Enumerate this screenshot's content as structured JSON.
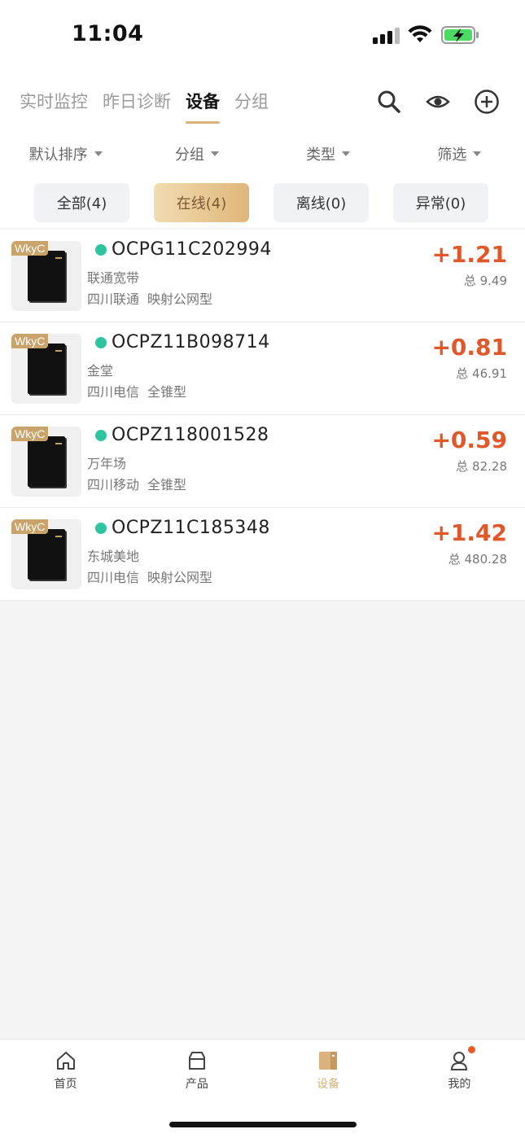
{
  "status_bar": {
    "time": "11:04"
  },
  "header": {
    "tabs": [
      {
        "label": "实时监控",
        "active": false
      },
      {
        "label": "昨日诊断",
        "active": false
      },
      {
        "label": "设备",
        "active": true
      },
      {
        "label": "分组",
        "active": false
      }
    ],
    "icons": [
      "search-icon",
      "eye-icon",
      "add-circle-icon"
    ],
    "sort_options": [
      {
        "label": "默认排序"
      },
      {
        "label": "分组"
      },
      {
        "label": "类型"
      },
      {
        "label": "筛选"
      }
    ],
    "filters": [
      {
        "label": "全部(4)",
        "active": false
      },
      {
        "label": "在线(4)",
        "active": true
      },
      {
        "label": "离线(0)",
        "active": false
      },
      {
        "label": "异常(0)",
        "active": false
      }
    ]
  },
  "devices": [
    {
      "tag": "WkyC",
      "id": "OCPG11C202994",
      "name": "联通宽带",
      "isp": "四川联通",
      "type": "映射公网型",
      "delta": "+1.21",
      "total": "总 9.49",
      "online": true
    },
    {
      "tag": "WkyC",
      "id": "OCPZ11B098714",
      "name": "金堂",
      "isp": "四川电信",
      "type": "全锥型",
      "delta": "+0.81",
      "total": "总 46.91",
      "online": true
    },
    {
      "tag": "WkyC",
      "id": "OCPZ118001528",
      "name": "万年场",
      "isp": "四川移动",
      "type": "全锥型",
      "delta": "+0.59",
      "total": "总 82.28",
      "online": true
    },
    {
      "tag": "WkyC",
      "id": "OCPZ11C185348",
      "name": "东城美地",
      "isp": "四川电信",
      "type": "映射公网型",
      "delta": "+1.42",
      "total": "总 480.28",
      "online": true
    }
  ],
  "bottom_nav": [
    {
      "label": "首页",
      "icon": "home-icon",
      "active": false
    },
    {
      "label": "产品",
      "icon": "box-icon",
      "active": false
    },
    {
      "label": "设备",
      "icon": "device-icon",
      "active": true
    },
    {
      "label": "我的",
      "icon": "profile-icon",
      "active": false,
      "badge": true
    }
  ],
  "colors": {
    "accent": "#d9b27c",
    "delta": "#e0582a",
    "online": "#2ec4a0",
    "badge": "#f05a28"
  }
}
